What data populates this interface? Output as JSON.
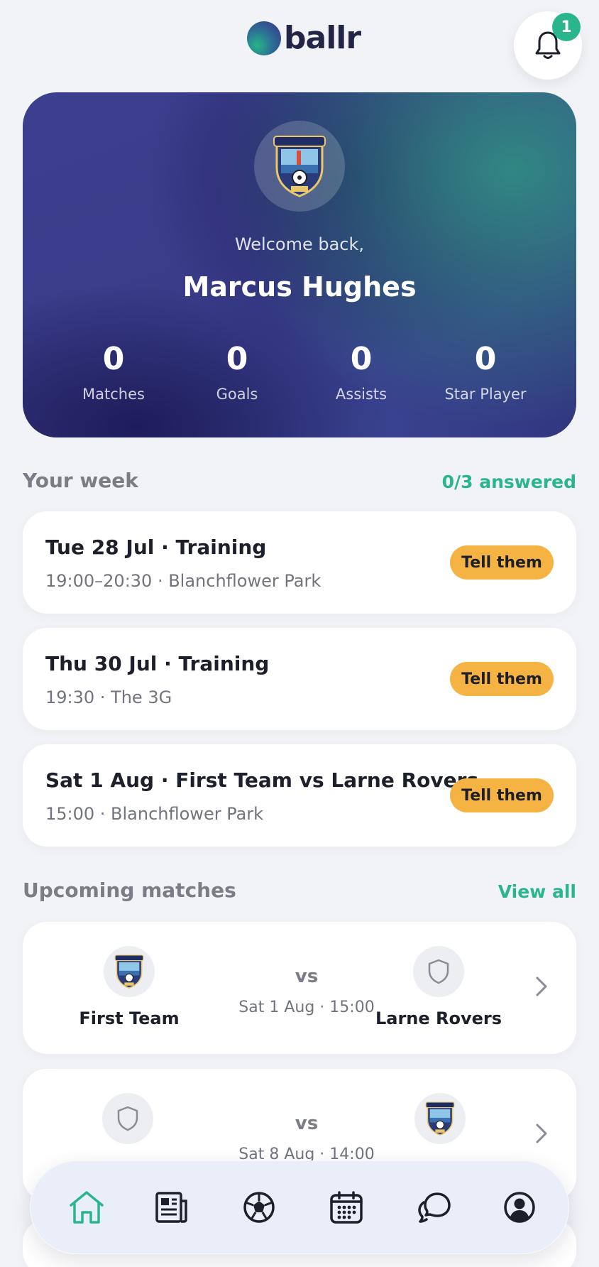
{
  "header": {
    "logo_text": "ballr",
    "notifications_count": "1"
  },
  "hero": {
    "welcome": "Welcome back,",
    "name": "Marcus Hughes",
    "stats": [
      {
        "value": "0",
        "label": "Matches"
      },
      {
        "value": "0",
        "label": "Goals"
      },
      {
        "value": "0",
        "label": "Assists"
      },
      {
        "value": "0",
        "label": "Star Player"
      }
    ]
  },
  "week": {
    "title": "Your week",
    "status": "0/3 answered",
    "items": [
      {
        "title": "Tue 28 Jul · Training",
        "sub": "19:00–20:30 · Blanchflower Park",
        "button": "Tell them"
      },
      {
        "title": "Thu 30 Jul · Training",
        "sub": "19:30 · The 3G",
        "button": "Tell them"
      },
      {
        "title": "Sat 1 Aug · First Team vs Larne Rovers",
        "sub": "15:00 · Blanchflower Park",
        "button": "Tell them"
      }
    ]
  },
  "matches": {
    "title": "Upcoming matches",
    "view_all": "View all",
    "items": [
      {
        "home": "First Team",
        "away": "Larne Rovers",
        "vs": "vs",
        "time": "Sat 1 Aug · 15:00",
        "home_logo": "club-crest",
        "away_logo": "shield-icon"
      },
      {
        "home": "",
        "away": "",
        "vs": "vs",
        "time": "Sat 8 Aug · 14:00",
        "home_logo": "shield-icon",
        "away_logo": "club-crest"
      }
    ]
  },
  "nav": {
    "items": [
      {
        "icon": "home-icon",
        "active": true
      },
      {
        "icon": "news-icon",
        "active": false
      },
      {
        "icon": "football-icon",
        "active": false
      },
      {
        "icon": "calendar-icon",
        "active": false
      },
      {
        "icon": "chat-icon",
        "active": false
      },
      {
        "icon": "profile-icon",
        "active": false
      }
    ]
  },
  "colors": {
    "accent": "#2bb58d",
    "button": "#f5b344",
    "background": "#f2f3f6"
  }
}
